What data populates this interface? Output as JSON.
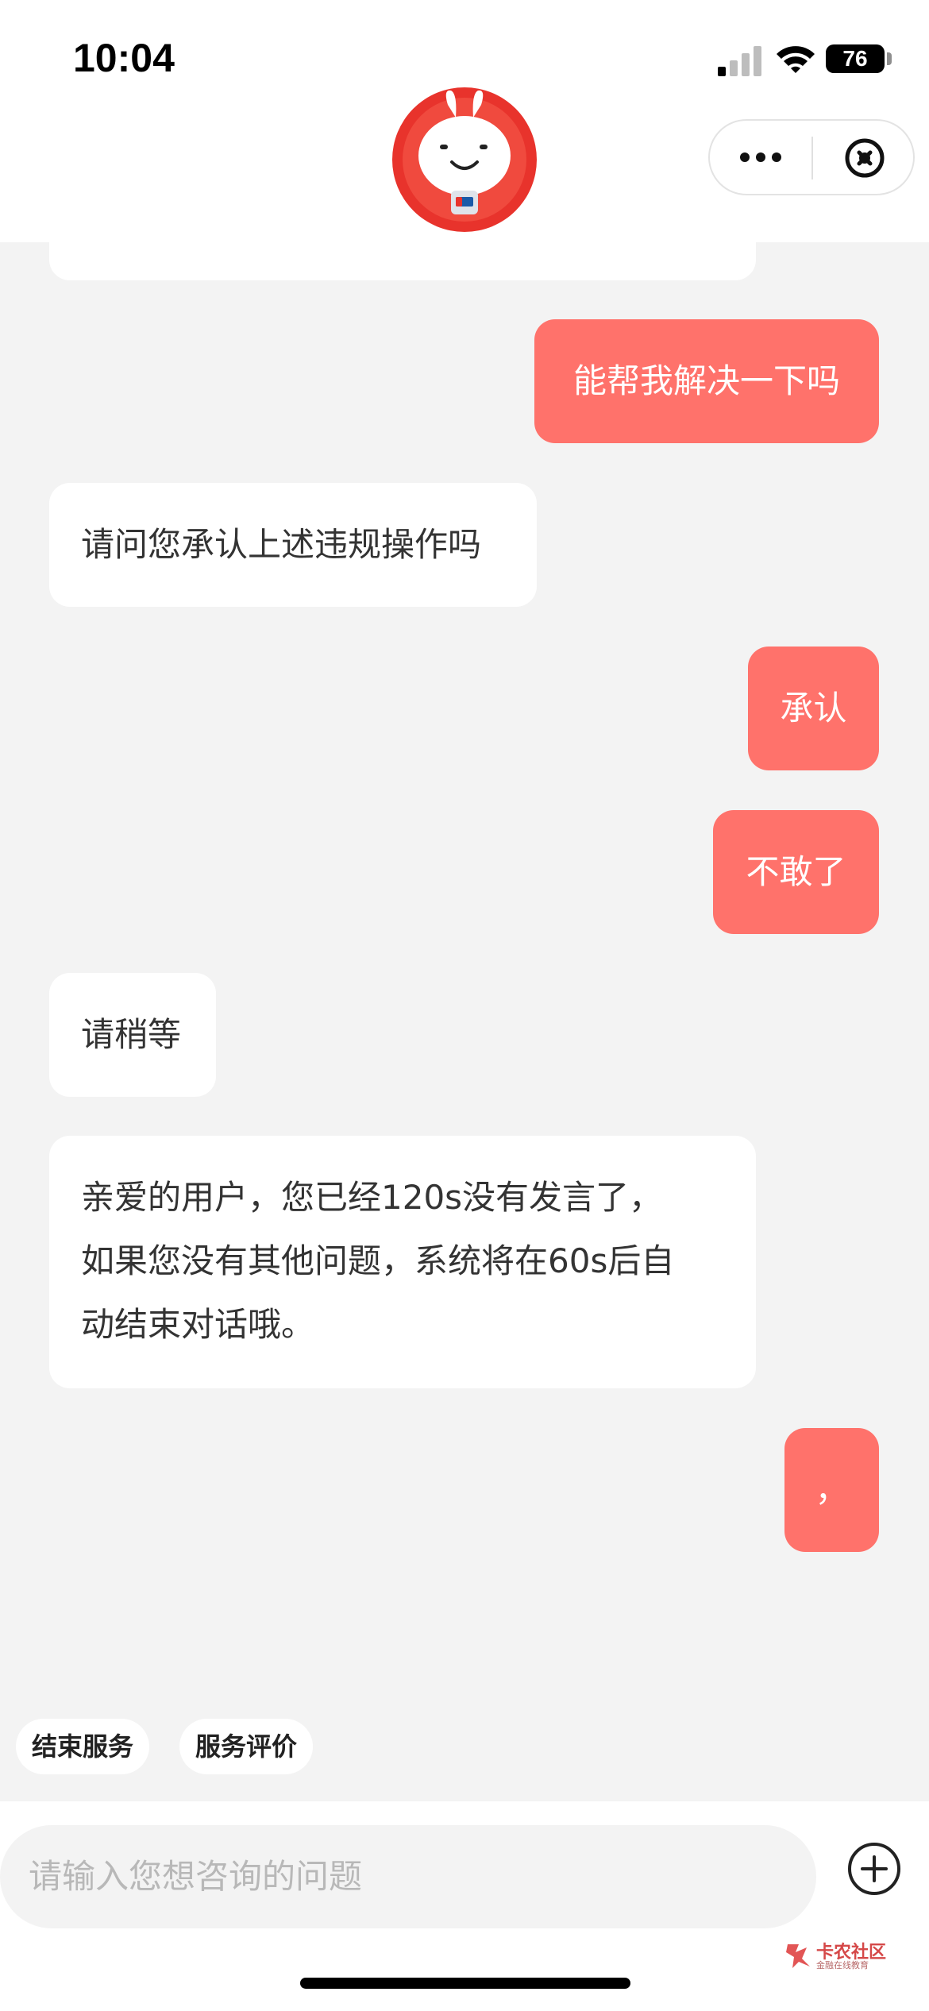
{
  "status_bar": {
    "time": "10:04",
    "battery": "76"
  },
  "header": {
    "avatar_icon": "rabbit-mascot-icon",
    "more_icon": "more-dots-icon",
    "close_icon": "close-circle-icon"
  },
  "messages": [
    {
      "from": "user",
      "text": "能帮我解决一下吗"
    },
    {
      "from": "agent",
      "text": "请问您承认上述违规操作吗"
    },
    {
      "from": "user",
      "text": "承认"
    },
    {
      "from": "user",
      "text": "不敢了"
    },
    {
      "from": "agent",
      "text": "请稍等"
    },
    {
      "from": "agent",
      "lines": [
        "亲爱的用户，您已经120s没有发言了，",
        "如果您没有其他问题，系统将在60s后自",
        "动结束对话哦。"
      ]
    },
    {
      "from": "user",
      "text": "，"
    }
  ],
  "quick_actions": {
    "end_service": "结束服务",
    "rate_service": "服务评价"
  },
  "input": {
    "placeholder": "请输入您想咨询的问题"
  },
  "watermark": {
    "title": "卡农社区",
    "subtitle": "金融在线教育"
  },
  "colors": {
    "user_bubble": "#ff726b",
    "agent_bubble": "#ffffff",
    "background": "#f3f3f3"
  }
}
